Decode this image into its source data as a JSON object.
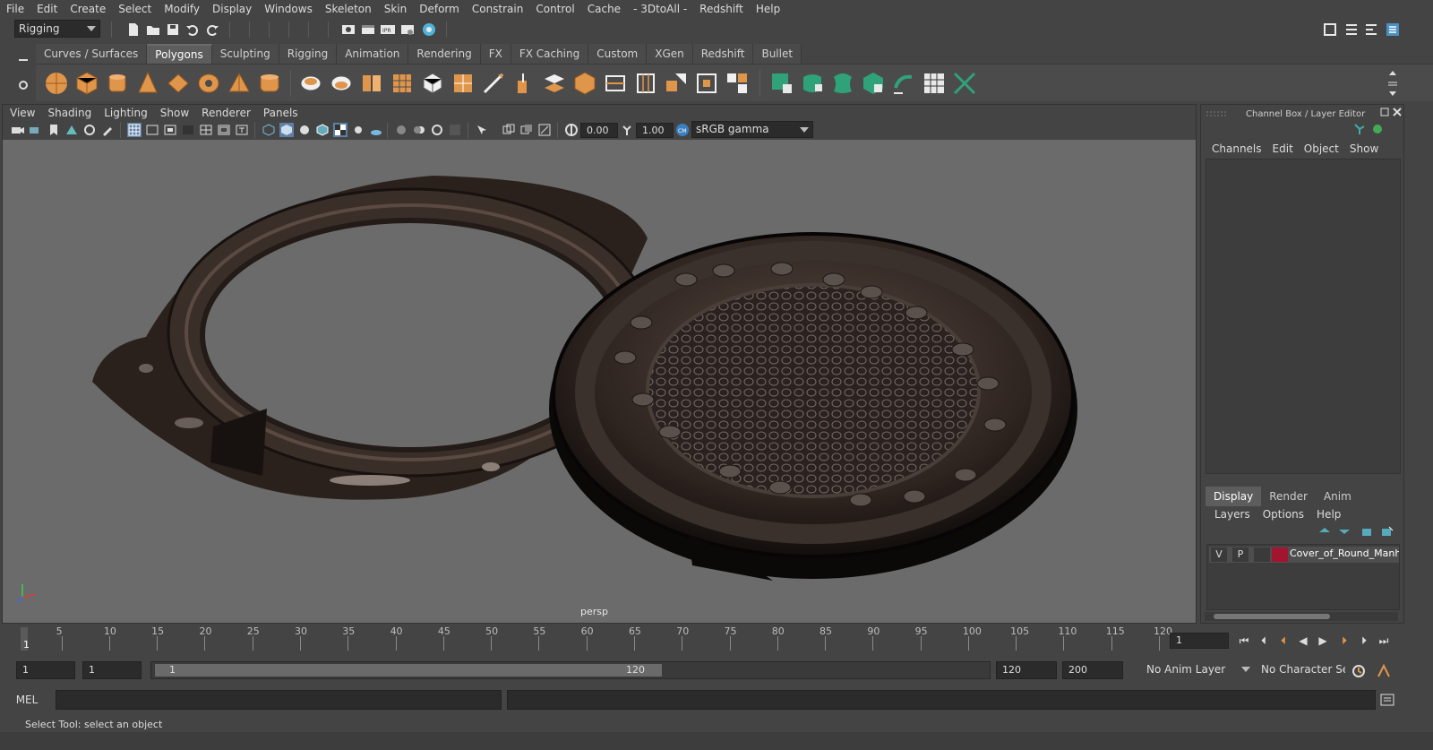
{
  "menubar": {
    "items": [
      "File",
      "Edit",
      "Create",
      "Select",
      "Modify",
      "Display",
      "Windows",
      "Skeleton",
      "Skin",
      "Deform",
      "Constrain",
      "Control",
      "Cache",
      "- 3DtoAll -",
      "Redshift",
      "Help"
    ]
  },
  "statusline": {
    "menuset": "Rigging"
  },
  "shelf": {
    "tabs": [
      "Curves / Surfaces",
      "Polygons",
      "Sculpting",
      "Rigging",
      "Animation",
      "Rendering",
      "FX",
      "FX Caching",
      "Custom",
      "XGen",
      "Redshift",
      "Bullet"
    ],
    "active_tab": "Polygons"
  },
  "viewport": {
    "menu": [
      "View",
      "Shading",
      "Lighting",
      "Show",
      "Renderer",
      "Panels"
    ],
    "exposure": "0.00",
    "gamma": "1.00",
    "color_space": "sRGB gamma",
    "camera_label": "persp"
  },
  "channelbox": {
    "title": "Channel Box / Layer Editor",
    "menu": [
      "Channels",
      "Edit",
      "Object",
      "Show"
    ],
    "layer_tabs": [
      "Display",
      "Render",
      "Anim"
    ],
    "active_layer_tab": "Display",
    "layer_menu": [
      "Layers",
      "Options",
      "Help"
    ],
    "layer": {
      "v": "V",
      "p": "P",
      "color": "#a3142e",
      "name": "Cover_of_Round_Manhole"
    }
  },
  "timeline": {
    "ticks": [
      "5",
      "10",
      "15",
      "20",
      "25",
      "30",
      "35",
      "40",
      "45",
      "50",
      "55",
      "60",
      "65",
      "70",
      "75",
      "80",
      "85",
      "90",
      "95",
      "100",
      "105",
      "110",
      "115",
      "120"
    ],
    "current_frame": "1",
    "frame_field": "1"
  },
  "range": {
    "start_field": "1",
    "anim_start_field": "1",
    "slider_start": "1",
    "slider_end": "120",
    "end_field": "120",
    "anim_end_field": "200",
    "anim_layer": "No Anim Layer",
    "character_set": "No Character Set"
  },
  "cmdline": {
    "label": "MEL"
  },
  "helpline": {
    "text": "Select Tool: select an object"
  },
  "colors": {
    "accent": "#5d5d5d",
    "shelf_orange": "#e0964a",
    "shelf_teal": "#2fa27a"
  }
}
